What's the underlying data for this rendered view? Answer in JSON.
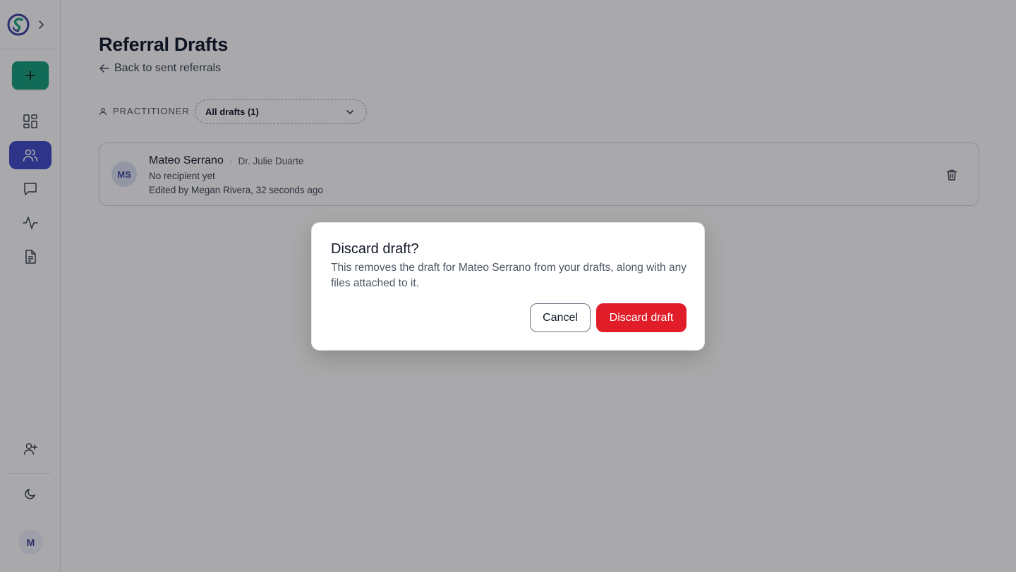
{
  "page": {
    "title": "Referral Drafts",
    "back_link": "Back to sent referrals"
  },
  "filter": {
    "label": "PRACTITIONER",
    "selected": "All drafts (1)"
  },
  "drafts": [
    {
      "initials": "MS",
      "patient": "Mateo Serrano",
      "separator": "·",
      "practitioner": "Dr. Julie Duarte",
      "recipient": "No recipient yet",
      "edited": "Edited by Megan Rivera, 32 seconds ago"
    }
  ],
  "user": {
    "initial": "M"
  },
  "modal": {
    "title": "Discard draft?",
    "body": "This removes the draft for Mateo Serrano from your drafts, along with any files attached to it.",
    "cancel_label": "Cancel",
    "confirm_label": "Discard draft"
  },
  "sidebar_icons": [
    "app-logo",
    "expand-sidebar-icon",
    "plus-icon",
    "dashboard-icon",
    "users-icon",
    "messages-icon",
    "activity-icon",
    "document-icon",
    "add-user-icon",
    "moon-icon"
  ],
  "colors": {
    "primary_green": "#129e7b",
    "active_nav": "#3f4ac9",
    "danger": "#e11d2a"
  }
}
